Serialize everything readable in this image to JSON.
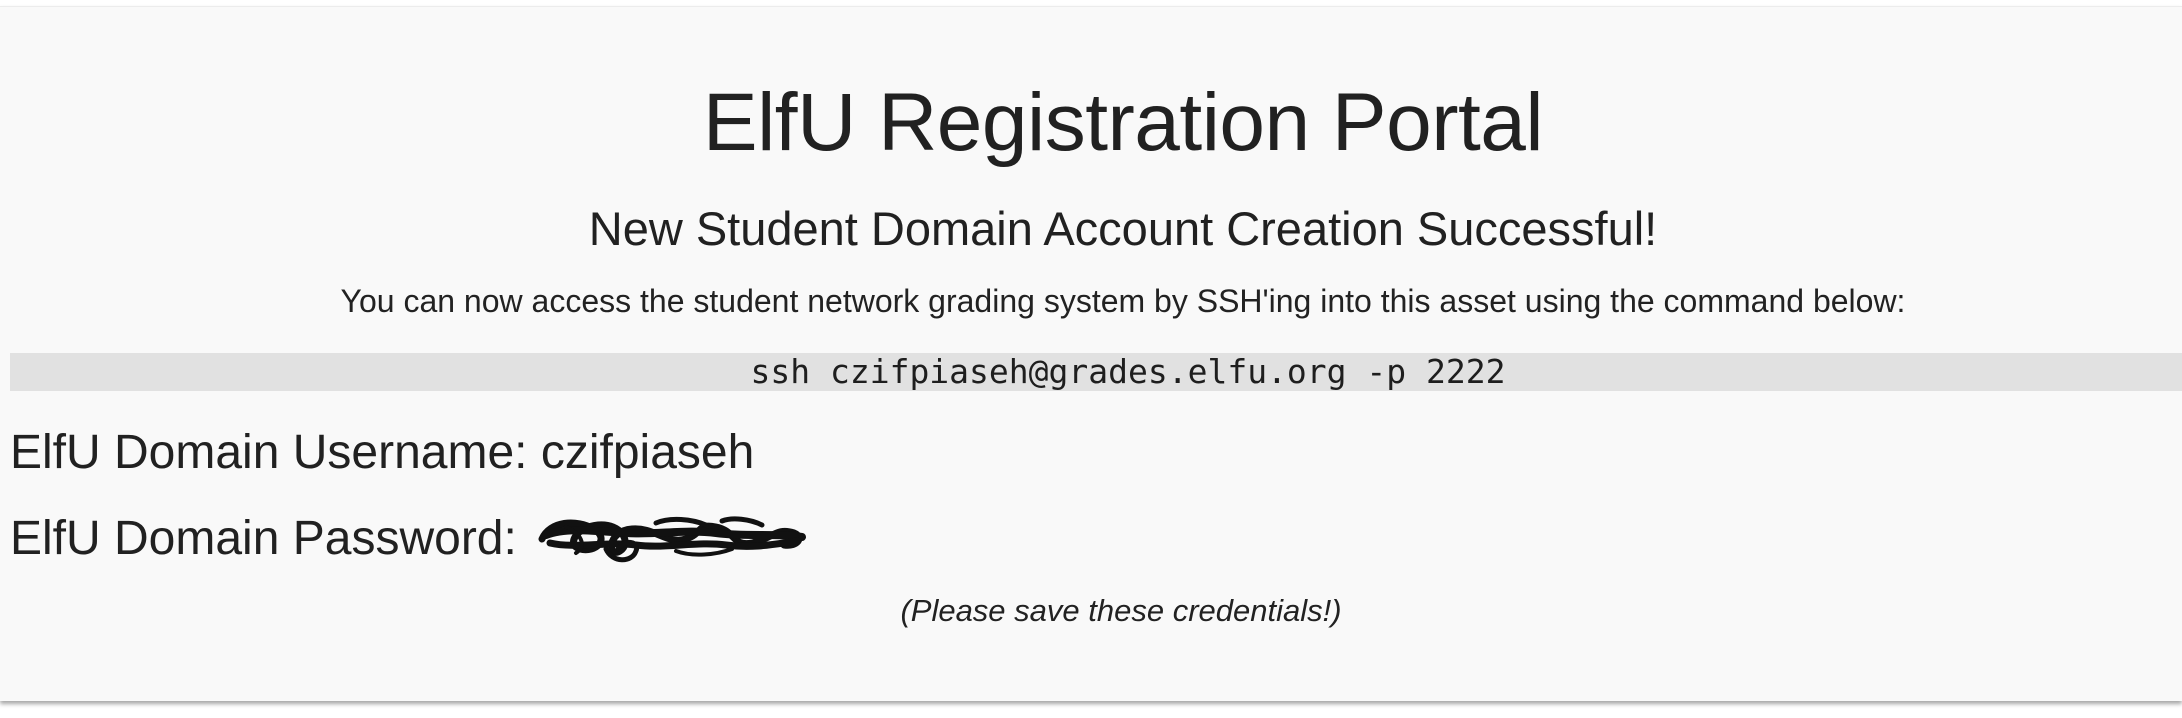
{
  "page": {
    "title": "ElfU Registration Portal",
    "subtitle": "New Student Domain Account Creation Successful!",
    "instructions": "You can now access the student network grading system by SSH'ing into this asset using the command below:",
    "command": "ssh czifpiaseh@grades.elfu.org -p 2222",
    "username_label": "ElfU Domain Username: ",
    "username_value": "czifpiaseh",
    "password_label": "ElfU Domain Password: ",
    "password_redacted": true,
    "note": "(Please save these credentials!)"
  },
  "colors": {
    "background": "#f9f9f9",
    "command_bar": "#e1e1e1",
    "text": "#212121",
    "redaction": "#111111"
  }
}
